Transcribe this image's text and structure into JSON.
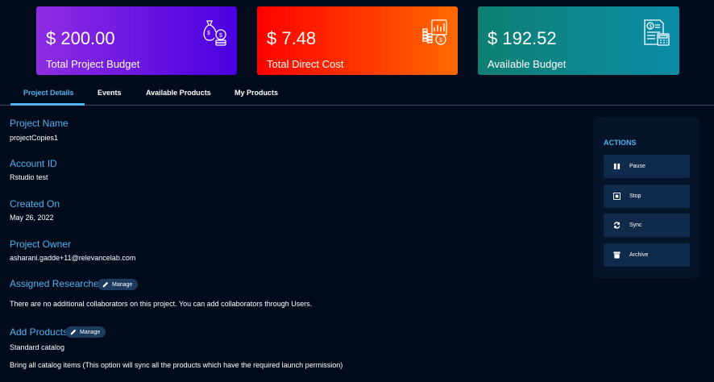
{
  "cards": {
    "budget": {
      "amount": "$ 200.00",
      "label": "Total Project Budget",
      "icon": "money-bag-coins-icon"
    },
    "cost": {
      "amount": "$ 7.48",
      "label": "Total Direct Cost",
      "icon": "coins-chart-icon"
    },
    "available": {
      "amount": "$ 192.52",
      "label": "Available Budget",
      "icon": "invoice-calculator-icon"
    }
  },
  "tabs": [
    {
      "label": "Project Details"
    },
    {
      "label": "Events"
    },
    {
      "label": "Available Products"
    },
    {
      "label": "My Products"
    }
  ],
  "details": {
    "project_name_label": "Project Name",
    "project_name": "projectCopies1",
    "account_id_label": "Account ID",
    "account_id": "Rstudio test",
    "created_on_label": "Created On",
    "created_on": "May 26, 2022",
    "owner_label": "Project Owner",
    "owner": "asharani.gadde+11@relevancelab.com",
    "researchers_label": "Assigned Researchers",
    "researchers_text": "There are no additional collaborators on this project. You can add collaborators through Users.",
    "products_label": "Add Products",
    "catalog": "Standard catalog",
    "catalog_note": "Bring all catalog items (This option will sync all the products which have the required launch permission)",
    "manage_label": "Manage"
  },
  "actions": {
    "title": "ACTIONS",
    "buttons": [
      {
        "label": "Pause",
        "icon": "pause-icon"
      },
      {
        "label": "Stop",
        "icon": "stop-icon"
      },
      {
        "label": "Sync",
        "icon": "sync-icon"
      },
      {
        "label": "Archive",
        "icon": "archive-icon"
      }
    ]
  },
  "colors": {
    "background": "#020b1c",
    "accent": "#4fb3ee",
    "button": "#0f2a4a"
  }
}
